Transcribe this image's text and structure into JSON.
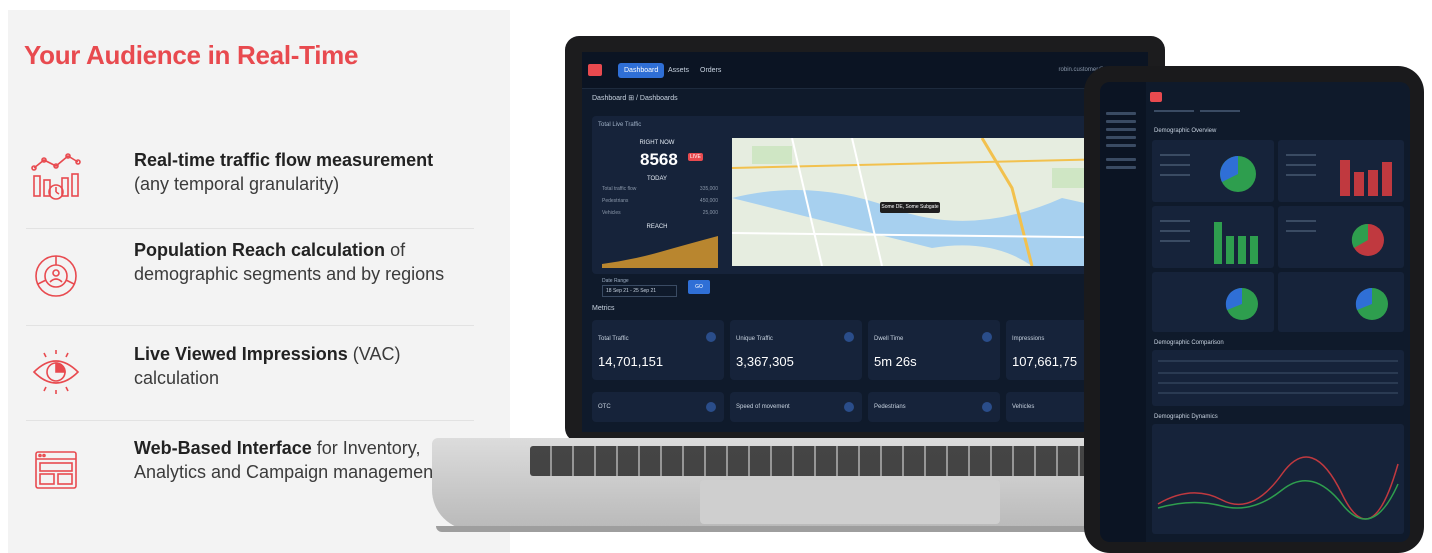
{
  "headline": "Your Audience in Real-Time",
  "features": [
    {
      "icon": "traffic-flow-icon",
      "bold": "Real-time traffic flow measurement",
      "rest": "(any temporal granularity)"
    },
    {
      "icon": "population-reach-icon",
      "bold": "Population Reach calculation",
      "rest": "of demographic segments and by regions"
    },
    {
      "icon": "eye-chart-icon",
      "bold": "Live Viewed Impressions",
      "rest": "(VAC) calculation"
    },
    {
      "icon": "web-interface-icon",
      "bold": "Web-Based Interface",
      "rest": "for Inventory, Analytics and Campaign management"
    }
  ],
  "laptop": {
    "nav_tabs": [
      "Dashboard",
      "Assets",
      "Orders"
    ],
    "nav_right": "robin.customer@example.com",
    "breadcrumb": "Dashboard  ⊞  / Dashboards",
    "panel_title": "Total Live Traffic",
    "right_now_label": "RIGHT NOW",
    "right_now_value": "8568",
    "live_badge": "LIVE",
    "today_label": "TODAY",
    "stats": [
      {
        "label": "Total traffic flow",
        "value": "335,000"
      },
      {
        "label": "Pedestrians",
        "value": "450,000"
      },
      {
        "label": "Vehicles",
        "value": "25,000"
      }
    ],
    "reach_label": "REACH",
    "map_tooltip": "Some DE, Some Subgate",
    "date_label": "Date Range",
    "date_value": "18 Sep 21 - 25 Sep 21",
    "go_button": "GO",
    "metrics_title": "Metrics",
    "metrics": [
      {
        "label": "Total Traffic",
        "value": "14,701,151"
      },
      {
        "label": "Unique Traffic",
        "value": "3,367,305"
      },
      {
        "label": "Dwell Time",
        "value": "5m 26s"
      },
      {
        "label": "Impressions",
        "value": "107,661,75"
      }
    ],
    "metrics_row2": [
      "OTC",
      "Speed of movement",
      "Pedestrians",
      "Vehicles"
    ]
  },
  "tablet": {
    "sections": [
      "Demographic Overview",
      "Demographic Comparison",
      "Demographic Dynamics"
    ]
  },
  "colors": {
    "accent": "#e84a4f",
    "dash_bg": "#0f1a2b",
    "panel": "#16233a",
    "blue": "#2f6fd6",
    "green": "#2e9e4e",
    "red": "#c0393f"
  }
}
